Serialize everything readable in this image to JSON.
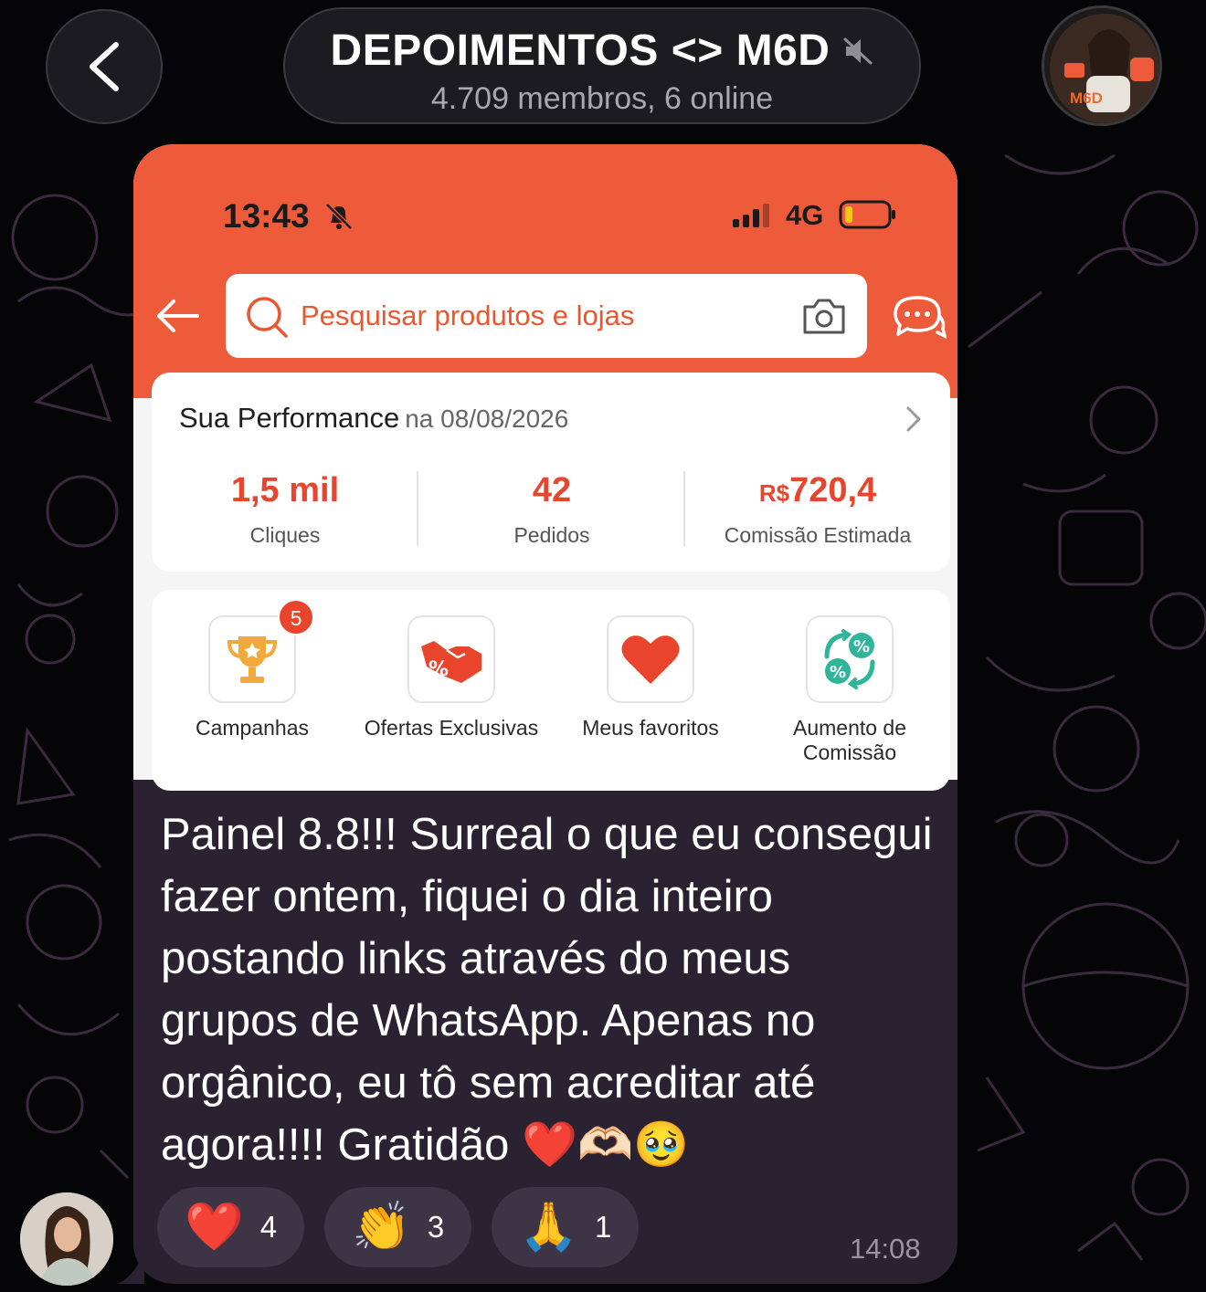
{
  "header": {
    "title": "DEPOIMENTOS <> M6D",
    "subtitle": "4.709 membros, 6 online",
    "back_icon": "chevron-left-icon",
    "muted_icon": "muted-speaker-icon",
    "channel_avatar_label": "M6D"
  },
  "screenshot": {
    "status_bar": {
      "time": "13:43",
      "network": "4G"
    },
    "search": {
      "placeholder": "Pesquisar produtos e lojas"
    },
    "performance": {
      "title": "Sua Performance",
      "date": "na 08/08/2026",
      "metrics": [
        {
          "value": "1,5 mil",
          "prefix": "",
          "label": "Cliques"
        },
        {
          "value": "42",
          "prefix": "",
          "label": "Pedidos"
        },
        {
          "value": "720,4",
          "prefix": "R$",
          "label": "Comissão Estimada"
        }
      ]
    },
    "shortcuts": [
      {
        "label": "Campanhas",
        "badge": "5",
        "icon": "trophy-icon"
      },
      {
        "label": "Ofertas Exclusivas",
        "icon": "handshake-icon"
      },
      {
        "label": "Meus favoritos",
        "icon": "heart-icon"
      },
      {
        "label": "Aumento de Comissão",
        "icon": "percent-cycle-icon"
      }
    ]
  },
  "message": {
    "text": "Painel 8.8!!! Surreal o que eu consegui fazer ontem, fiquei o dia inteiro postando links através do meus grupos de WhatsApp. Apenas no orgânico, eu tô sem acreditar até agora!!!! Gratidão ❤️🫶🏻🥹",
    "time": "14:08",
    "reactions": [
      {
        "emoji": "❤️",
        "count": "4"
      },
      {
        "emoji": "👏",
        "count": "3"
      },
      {
        "emoji": "🙏",
        "count": "1"
      }
    ]
  },
  "colors": {
    "shopee_orange": "#ee5b3a",
    "metric_red": "#e8452c",
    "bubble_bg": "#2a2230",
    "header_bg": "#1c1b1f"
  }
}
